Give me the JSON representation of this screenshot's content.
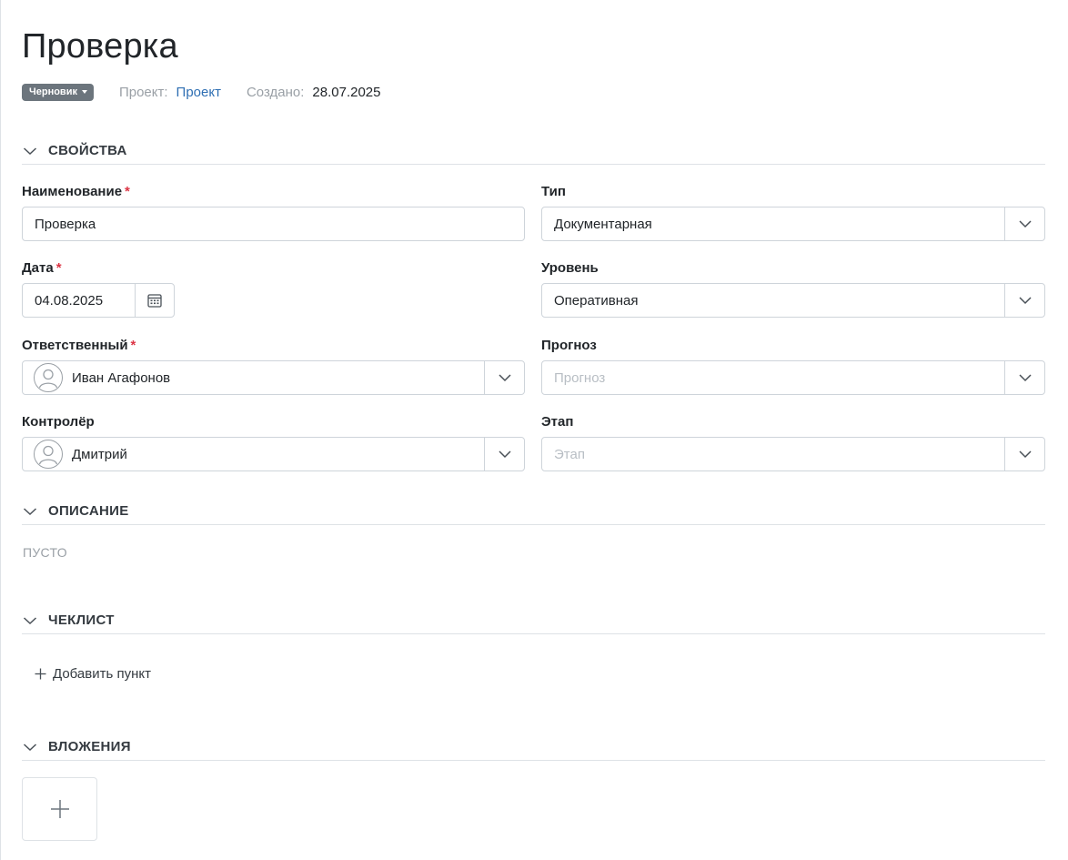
{
  "page": {
    "title": "Проверка"
  },
  "meta": {
    "status": "Черновик",
    "project_label": "Проект:",
    "project_value": "Проект",
    "created_label": "Создано:",
    "created_value": "28.07.2025"
  },
  "sections": {
    "properties": "СВОЙСТВА",
    "description": "ОПИСАНИЕ",
    "checklist": "ЧЕКЛИСТ",
    "attachments": "ВЛОЖЕНИЯ"
  },
  "fields": {
    "name": {
      "label": "Наименование",
      "required_mark": "*",
      "value": "Проверка"
    },
    "type": {
      "label": "Тип",
      "value": "Документарная"
    },
    "date": {
      "label": "Дата",
      "required_mark": "*",
      "value": "04.08.2025"
    },
    "level": {
      "label": "Уровень",
      "value": "Оперативная"
    },
    "responsible": {
      "label": "Ответственный",
      "required_mark": "*",
      "value": "Иван Агафонов"
    },
    "forecast": {
      "label": "Прогноз",
      "placeholder": "Прогноз"
    },
    "controller": {
      "label": "Контролёр",
      "value": "Дмитрий"
    },
    "stage": {
      "label": "Этап",
      "placeholder": "Этап"
    }
  },
  "description": {
    "empty_text": "ПУСТО"
  },
  "checklist": {
    "add_label": "Добавить пункт"
  },
  "icons": {
    "status_caret": "caret-down-icon",
    "section_chevron": "chevron-down-icon",
    "select_chevron": "chevron-down-icon",
    "calendar": "calendar-icon",
    "avatar": "user-avatar-icon",
    "add": "plus-icon"
  },
  "colors": {
    "badge_bg": "#6c757d",
    "link": "#2f6fb3",
    "required": "#dc3545",
    "border": "#ced4da",
    "divider": "#dee2e6",
    "muted": "#9aa0a6"
  }
}
